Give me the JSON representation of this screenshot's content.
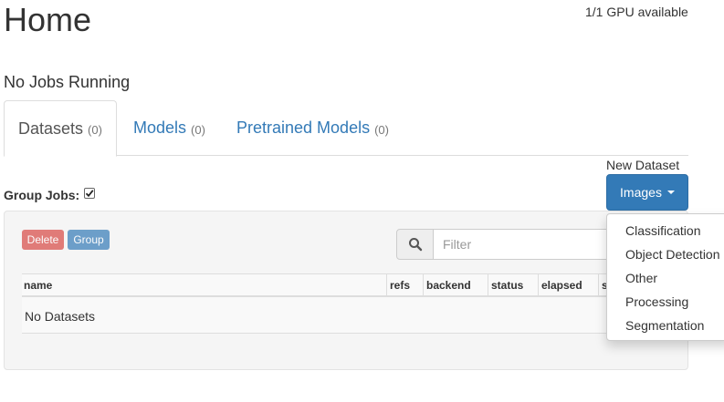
{
  "header": {
    "title": "Home",
    "gpu_status": "1/1 GPU available",
    "jobs_status": "No Jobs Running"
  },
  "tabs": [
    {
      "label": "Datasets",
      "count": "(0)",
      "active": true
    },
    {
      "label": "Models",
      "count": "(0)",
      "active": false
    },
    {
      "label": "Pretrained Models",
      "count": "(0)",
      "active": false
    }
  ],
  "new_dataset": {
    "label": "New Dataset",
    "button_label": "Images",
    "menu_items": [
      "Classification",
      "Object Detection",
      "Other",
      "Processing",
      "Segmentation"
    ]
  },
  "group_jobs": {
    "label": "Group Jobs:",
    "checked": true
  },
  "toolbar": {
    "delete_label": "Delete",
    "group_label": "Group",
    "search_icon": "search-icon",
    "filter_placeholder": "Filter"
  },
  "table": {
    "columns": [
      "name",
      "refs",
      "backend",
      "status",
      "elapsed",
      "s"
    ],
    "empty_message": "No Datasets"
  },
  "colors": {
    "primary": "#337ab7",
    "danger": "#d9534f",
    "link": "#337ab7"
  }
}
